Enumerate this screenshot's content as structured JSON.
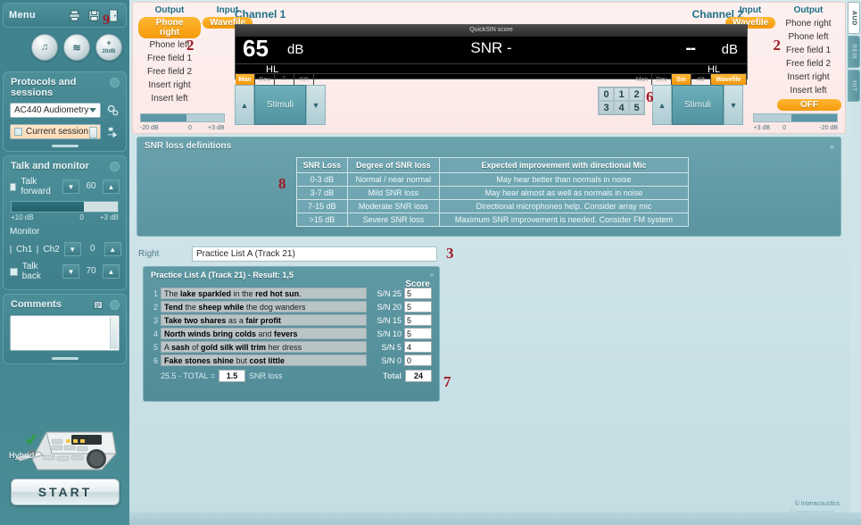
{
  "app": {
    "menu_label": "Menu",
    "copyright": "© Interacoustics",
    "copyright_shadow": "© Interacoustics",
    "start_label": "START",
    "device_label": "Hybrid"
  },
  "annotations": {
    "a9": "9",
    "a2_left": "2",
    "a2_right": "2",
    "a6": "6",
    "a8": "8",
    "a3": "3",
    "a7": "7"
  },
  "header_icons": [
    {
      "name": "print-icon",
      "glyph": "⎙"
    },
    {
      "name": "save-icon",
      "glyph": "💾"
    },
    {
      "name": "exit-icon",
      "glyph": "🚪"
    }
  ],
  "round_icons": [
    {
      "name": "tone-icon",
      "glyph": "♫"
    },
    {
      "name": "speech-icon",
      "glyph": "≋"
    },
    {
      "name": "boost-icon",
      "glyph": "20dB"
    }
  ],
  "protocols": {
    "title": "Protocols and sessions",
    "protocol_value": "AC440 Audiometry",
    "session_value": "Current session"
  },
  "talk_monitor": {
    "title": "Talk and monitor",
    "talk_forward_label": "Talk forward",
    "talk_forward_value": "60",
    "scale_min": "+10 dB",
    "scale_mid": "0",
    "scale_max": "+3 dB",
    "monitor_label": "Monitor",
    "ch1_label": "Ch1",
    "ch2_label": "Ch2",
    "monitor_value": "0",
    "talk_back_label": "Talk back",
    "talk_back_value": "70"
  },
  "comments": {
    "title": "Comments",
    "text": ""
  },
  "channel1": {
    "title": "Channel 1",
    "output_head": "Output",
    "input_head": "Input",
    "output_selected": "Phone right",
    "input_selected": "Wavefile",
    "output_items": [
      "Phone left",
      "Free field 1",
      "Free field 2",
      "Insert right",
      "Insert left"
    ],
    "level": "65",
    "unit": "dB",
    "hl": "HL",
    "buttons": [
      {
        "label": "Man",
        "active": true
      },
      {
        "label": "Rev",
        "active": false
      },
      {
        "label": "⎍",
        "active": false
      },
      {
        "label": "⊓⊓",
        "active": false
      }
    ],
    "vu_min": "-20 dB",
    "vu_mid": "0",
    "vu_max": "+3 dB",
    "stimuli_label": "Stimuli"
  },
  "channel2": {
    "title": "Channel 2",
    "input_head": "Input",
    "output_head": "Output",
    "input_selected": "Wavefile",
    "output_items": [
      "Phone right",
      "Phone left",
      "Free field 1",
      "Free field 2",
      "Insert right",
      "Insert left"
    ],
    "output_selected": "OFF",
    "level": "--",
    "unit": "dB",
    "hl": "HL",
    "buttons": [
      {
        "label": "Man",
        "active": false
      },
      {
        "label": "Rev",
        "active": false
      },
      {
        "label": "Sin",
        "active": true
      },
      {
        "label": "Alt",
        "active": false
      },
      {
        "label": "Wavefile",
        "active": true
      }
    ],
    "vu_min": "+3 dB",
    "vu_mid": "0",
    "vu_max": "-20 dB",
    "stimuli_label": "Stimuli"
  },
  "quicksin": {
    "score_label": "QuickSIN score",
    "snr_text": "SNR -"
  },
  "numpad": [
    "0",
    "1",
    "2",
    "3",
    "4",
    "5"
  ],
  "snr_definitions": {
    "title": "SNR loss definitions",
    "columns": [
      "SNR Loss",
      "Degree of SNR loss",
      "Expected improvement with directional Mic"
    ],
    "rows": [
      [
        "0-3 dB",
        "Normal / near normal",
        "May hear better than normals in noise"
      ],
      [
        "3-7 dB",
        "Mild SNR loss",
        "May hear almost as well as normals in noise"
      ],
      [
        "7-15 dB",
        "Moderate SNR loss",
        "Directional microphones help. Consider array mic"
      ],
      [
        ">15 dB",
        "Severe SNR loss",
        "Maximum SNR improvement is needed. Consider FM system"
      ]
    ]
  },
  "list_select": {
    "side_label": "Right",
    "value": "Practice List A (Track 21)"
  },
  "practice": {
    "title": "Practice List A (Track 21)  -  Result: 1,5",
    "score_header": "Score",
    "sentences": [
      {
        "n": "1",
        "pre": "The ",
        "b1": "lake sparkled",
        "mid": " in the ",
        "b2": "red hot sun",
        "post": ".",
        "sn": "S/N 25",
        "score": "5"
      },
      {
        "n": "2",
        "pre": "",
        "b1": "Tend",
        "mid": " the ",
        "b2": "sheep while",
        "post": " the dog wanders",
        "sn": "S/N 20",
        "score": "5"
      },
      {
        "n": "3",
        "pre": "",
        "b1": "Take two shares",
        "mid": " as a ",
        "b2": "fair profit",
        "post": "",
        "sn": "S/N 15",
        "score": "5"
      },
      {
        "n": "4",
        "pre": "",
        "b1": "North winds bring colds",
        "mid": " and ",
        "b2": "fevers",
        "post": "",
        "sn": "S/N 10",
        "score": "5"
      },
      {
        "n": "5",
        "pre": "A ",
        "b1": "sash",
        "mid": " of ",
        "b2": "gold silk will trim",
        "post": " her dress",
        "sn": "S/N 5",
        "score": "4"
      },
      {
        "n": "6",
        "pre": "",
        "b1": "Fake stones shine",
        "mid": " but ",
        "b2": "cost little",
        "post": "",
        "sn": "S/N 0",
        "score": "0"
      }
    ],
    "total_prefix": "25.5 - TOTAL =",
    "snr_loss_value": "1.5",
    "total_suffix": "SNR loss",
    "total_label": "Total",
    "total_value": "24"
  },
  "vtabs": [
    {
      "label": "AUD",
      "active": true
    },
    {
      "label": "REM",
      "active": false
    },
    {
      "label": "HIT",
      "active": false
    }
  ]
}
